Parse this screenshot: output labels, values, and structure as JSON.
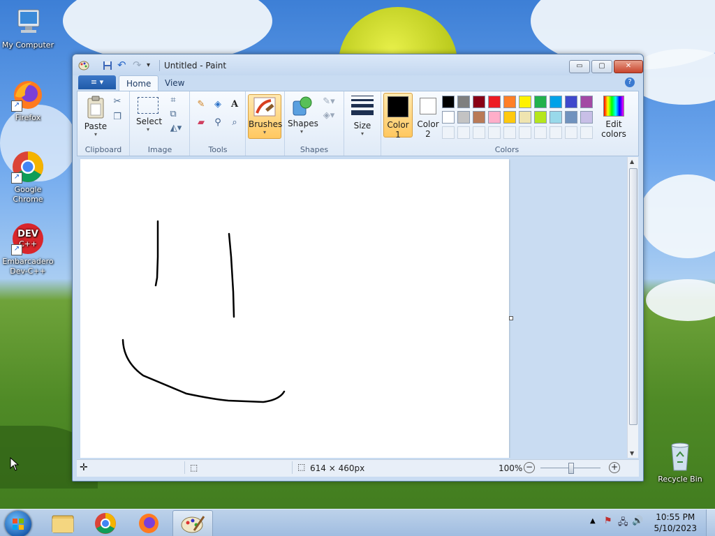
{
  "desktop": {
    "icons": [
      {
        "label": "My Computer"
      },
      {
        "label": "Firefox"
      },
      {
        "label": "Google Chrome"
      },
      {
        "label": "Embarcadero Dev-C++"
      },
      {
        "label": "Recycle Bin"
      }
    ]
  },
  "window": {
    "title": "Untitled - Paint",
    "controls": {
      "minimize": "▭",
      "maximize": "▢",
      "close": "✕"
    }
  },
  "tabs": {
    "file": "≡ ▾",
    "home": "Home",
    "view": "View"
  },
  "ribbon": {
    "clipboard": {
      "paste": "Paste",
      "group": "Clipboard"
    },
    "image": {
      "select": "Select",
      "group": "Image"
    },
    "tools": {
      "group": "Tools"
    },
    "brushes": {
      "label": "Brushes"
    },
    "shapes": {
      "label": "Shapes",
      "group": "Shapes"
    },
    "size": {
      "label": "Size"
    },
    "colors": {
      "color1": "Color",
      "color1_num": "1",
      "color2": "Color",
      "color2_num": "2",
      "edit1": "Edit",
      "edit2": "colors",
      "group": "Colors",
      "color1_value": "#000000",
      "color2_value": "#ffffff",
      "palette_row1": [
        "#000000",
        "#7f7f7f",
        "#880015",
        "#ed1c24",
        "#ff7f27",
        "#fff200",
        "#22b14c",
        "#00a2e8",
        "#3f48cc",
        "#a349a4"
      ],
      "palette_row2": [
        "#ffffff",
        "#c3c3c3",
        "#b97a57",
        "#ffaec9",
        "#ffc90e",
        "#efe4b0",
        "#b5e61d",
        "#99d9ea",
        "#7092be",
        "#c8bfe7"
      ]
    }
  },
  "status": {
    "canvas_size": "614 × 460px",
    "zoom": "100%"
  },
  "taskbar": {
    "time": "10:55 PM",
    "date": "5/10/2023"
  }
}
